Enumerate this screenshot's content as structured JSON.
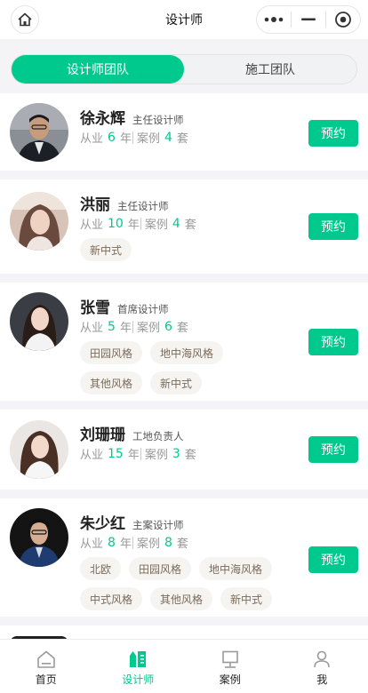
{
  "navbar": {
    "title": "设计师"
  },
  "tabs": [
    {
      "label": "设计师团队",
      "active": true
    },
    {
      "label": "施工团队",
      "active": false
    }
  ],
  "stats_labels": {
    "years_prefix": "从业",
    "years_unit": "年",
    "cases_prefix": "案例",
    "cases_unit": "套"
  },
  "book_label": "预约",
  "designers": [
    {
      "name": "徐永辉",
      "title": "主任设计师",
      "years": "6",
      "cases": "4",
      "tags": []
    },
    {
      "name": "洪丽",
      "title": "主任设计师",
      "years": "10",
      "cases": "4",
      "tags": [
        "新中式"
      ]
    },
    {
      "name": "张雪",
      "title": "首席设计师",
      "years": "5",
      "cases": "6",
      "tags": [
        "田园风格",
        "地中海风格",
        "其他风格",
        "新中式"
      ]
    },
    {
      "name": "刘珊珊",
      "title": "工地负责人",
      "years": "15",
      "cases": "3",
      "tags": []
    },
    {
      "name": "朱少红",
      "title": "主案设计师",
      "years": "8",
      "cases": "8",
      "tags": [
        "北欧",
        "田园风格",
        "地中海风格",
        "中式风格",
        "其他风格",
        "新中式"
      ]
    }
  ],
  "tabbar": [
    {
      "label": "首页",
      "icon": "home-icon",
      "active": false
    },
    {
      "label": "设计师",
      "icon": "designer-icon",
      "active": true
    },
    {
      "label": "案例",
      "icon": "case-icon",
      "active": false
    },
    {
      "label": "我",
      "icon": "user-icon",
      "active": false
    }
  ],
  "colors": {
    "accent": "#00c98d",
    "tag_bg": "#f6f4f1",
    "tag_text": "#7a6a5a"
  }
}
